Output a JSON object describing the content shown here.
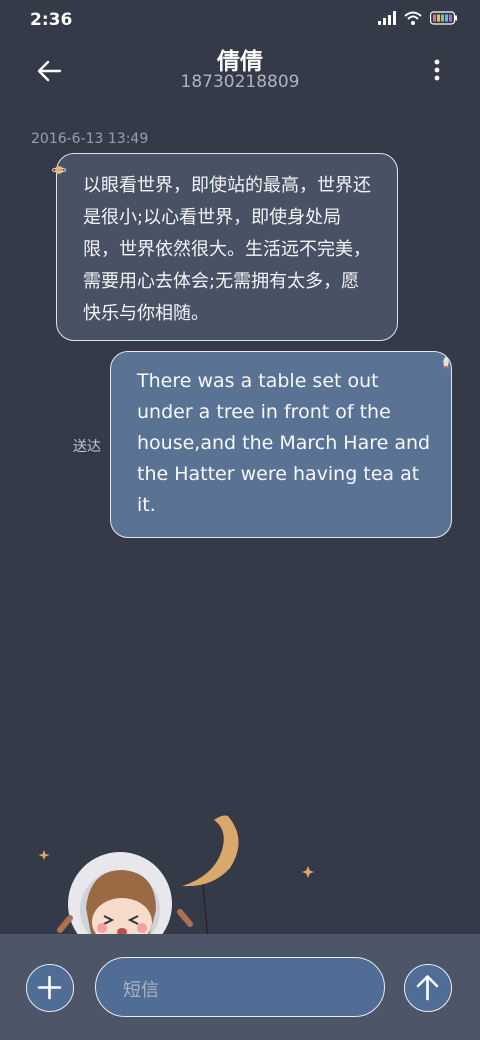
{
  "status_bar": {
    "time": "2:36"
  },
  "header": {
    "contact_name": "倩倩",
    "phone_number": "18730218809"
  },
  "conversation": {
    "timestamp": "2016-6-13 13:49",
    "incoming_message": "以眼看世界，即使站的最高，世界还是很小;以心看世界，即使身处局限，世界依然很大。生活远不完美，需要用心去体会;无需拥有太多，愿快乐与你相随。",
    "outgoing_message": "There was a table set out under a tree in front of the house,and the March Hare and the Hatter were having tea at it.",
    "outgoing_status": "送达"
  },
  "composer": {
    "placeholder": "短信"
  },
  "icons": {
    "back": "arrow-left-icon",
    "menu": "more-vertical-icon",
    "add": "plus-icon",
    "send": "arrow-up-icon",
    "signal": "signal-icon",
    "wifi": "wifi-icon",
    "battery": "battery-icon"
  },
  "colors": {
    "background": "#343a48",
    "incoming_bubble": "#485264",
    "outgoing_bubble": "#5a7395",
    "bottom_bar": "#4d5669",
    "button": "#4f6d95"
  }
}
